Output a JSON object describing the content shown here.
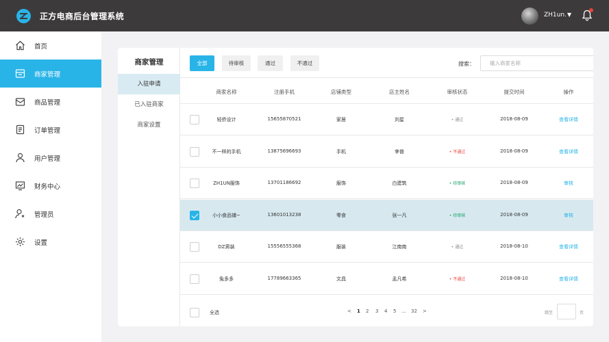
{
  "app": {
    "title": "正方电商后台管理系统",
    "username": "ZH1un."
  },
  "sidebar": {
    "items": [
      {
        "label": "首页",
        "icon": "home-icon"
      },
      {
        "label": "商家管理",
        "icon": "store-icon",
        "active": true
      },
      {
        "label": "商品管理",
        "icon": "box-icon"
      },
      {
        "label": "订单管理",
        "icon": "order-icon"
      },
      {
        "label": "用户管理",
        "icon": "user-icon"
      },
      {
        "label": "财务中心",
        "icon": "chart-icon"
      },
      {
        "label": "管理员",
        "icon": "admin-icon"
      },
      {
        "label": "设置",
        "icon": "gear-icon"
      }
    ]
  },
  "subnav": {
    "title": "商家管理",
    "items": [
      "入驻申请",
      "已入驻商家",
      "商家设置"
    ]
  },
  "filters": {
    "buttons": [
      "全部",
      "待审核",
      "通过",
      "不通过"
    ],
    "search_label": "搜索：",
    "search_placeholder": "输入商家名称",
    "query_label": "查询"
  },
  "table": {
    "headers": [
      "商家名称",
      "注册手机",
      "店铺类型",
      "店主姓名",
      "审核状态",
      "提交时间",
      "操作"
    ],
    "rows": [
      {
        "name": "轻侨设计",
        "phone": "15655870521",
        "type": "家居",
        "owner": "刘星",
        "status": "通过",
        "date": "2018-08-09",
        "action": "查看详情"
      },
      {
        "name": "不一样的手机",
        "phone": "13875696693",
        "type": "手机",
        "owner": "李普",
        "status": "不通过",
        "date": "2018-08-09",
        "action": "查看详情"
      },
      {
        "name": "ZH1UN服饰",
        "phone": "13701186692",
        "type": "服饰",
        "owner": "白建筑",
        "status": "待审核",
        "date": "2018-08-09",
        "action": "审核"
      },
      {
        "name": "小小食品铺~",
        "phone": "13601013238",
        "type": "零食",
        "owner": "张一凡",
        "status": "待审核",
        "date": "2018-08-09",
        "action": "审核",
        "selected": true
      },
      {
        "name": "DZ男装",
        "phone": "15556555368",
        "type": "服装",
        "owner": "江南南",
        "status": "通过",
        "date": "2018-08-10",
        "action": "查看详情"
      },
      {
        "name": "兔多多",
        "phone": "17789663365",
        "type": "文具",
        "owner": "孟凡希",
        "status": "不通过",
        "date": "2018-08-10",
        "action": "查看详情"
      }
    ]
  },
  "footer": {
    "select_all": "全选",
    "pages": [
      "<",
      "1",
      "2",
      "3",
      "4",
      "5",
      "...",
      "32",
      ">"
    ],
    "current_page": "1",
    "jump_label": "跳至",
    "page_unit": "页"
  },
  "colors": {
    "accent": "#29b4e8",
    "danger": "#e9423c",
    "topbar": "#3d3a3b"
  }
}
